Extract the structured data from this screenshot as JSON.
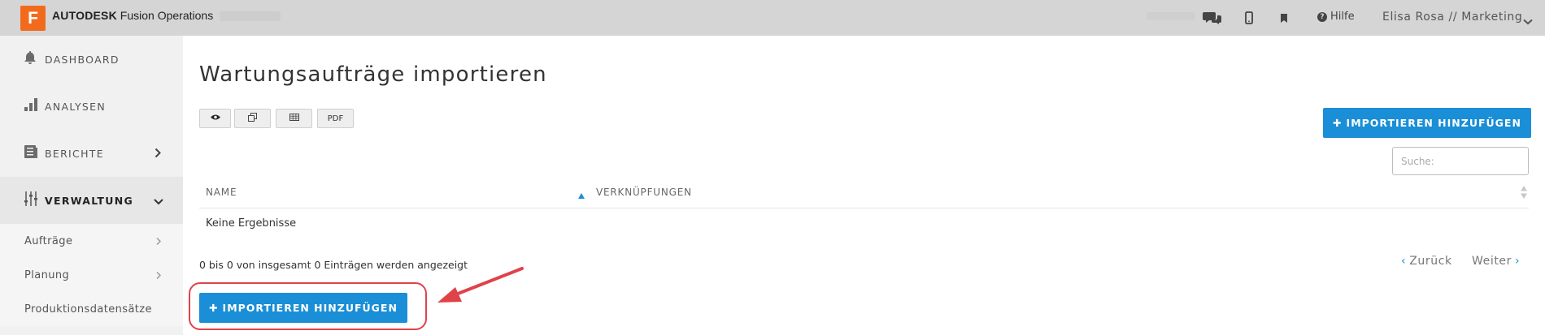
{
  "header": {
    "logo_letter": "F",
    "brand_bold": "AUTODESK",
    "brand_name": "Fusion Operations",
    "help_label": "Hilfe",
    "user_label": "Elisa Rosa // Marketing",
    "icons": [
      "chat-icon",
      "mobile-icon",
      "bookmark-icon",
      "help-icon",
      "chevron-down-icon"
    ]
  },
  "sidebar": {
    "items": [
      {
        "label": "DASHBOARD",
        "icon": "bell-icon"
      },
      {
        "label": "ANALYSEN",
        "icon": "bar-chart-icon"
      },
      {
        "label": "BERICHTE",
        "icon": "report-icon"
      },
      {
        "label": "VERWALTUNG",
        "icon": "sliders-icon",
        "active": true
      }
    ],
    "sub_items": [
      {
        "label": "Aufträge"
      },
      {
        "label": "Planung"
      },
      {
        "label": "Produktionsdatensätze"
      }
    ]
  },
  "main": {
    "title": "Wartungsaufträge importieren",
    "toolbar": {
      "icons": [
        "eye-icon",
        "copy-icon",
        "table-icon"
      ],
      "pdf_label": "PDF"
    },
    "add_button_label": "IMPORTIEREN HINZUFÜGEN",
    "search_placeholder": "Suche:",
    "table": {
      "columns": [
        "NAME",
        "VERKNÜPFUNGEN"
      ],
      "sorted_column": "NAME",
      "sort_direction": "ascending",
      "empty_text": "Keine Ergebnisse"
    },
    "info_text": "0 bis 0 von insgesamt 0 Einträgen werden angezeigt",
    "pagination": {
      "prev_label": "Zurück",
      "next_label": "Weiter"
    },
    "annotation_color": "#e0424a"
  },
  "colors": {
    "accent": "#1a8ed6",
    "brand": "#f26b1d",
    "header_bg": "#d5d5d5",
    "sidebar_bg": "#f1f1f1"
  }
}
